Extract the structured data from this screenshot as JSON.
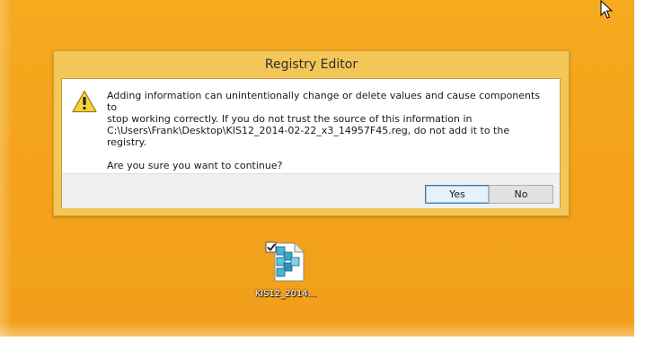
{
  "dialog": {
    "title": "Registry Editor",
    "message_line1": "Adding information can unintentionally change or delete values and cause components to",
    "message_line2": "stop working correctly. If you do not trust the source of this information in",
    "message_line3": "C:\\Users\\Frank\\Desktop\\KIS12_2014-02-22_x3_14957F45.reg, do not add it to the registry.",
    "question": "Are you sure you want to continue?",
    "buttons": {
      "yes": "Yes",
      "no": "No"
    },
    "icon": "warning-icon"
  },
  "desktop": {
    "file": {
      "label": "KIS12_2014...",
      "icon": "registry-file-icon",
      "checked": true
    }
  },
  "colors": {
    "desktop_bg": "#f5a623",
    "dialog_frame": "#f2c657",
    "default_button_border": "#3c7fb1"
  }
}
